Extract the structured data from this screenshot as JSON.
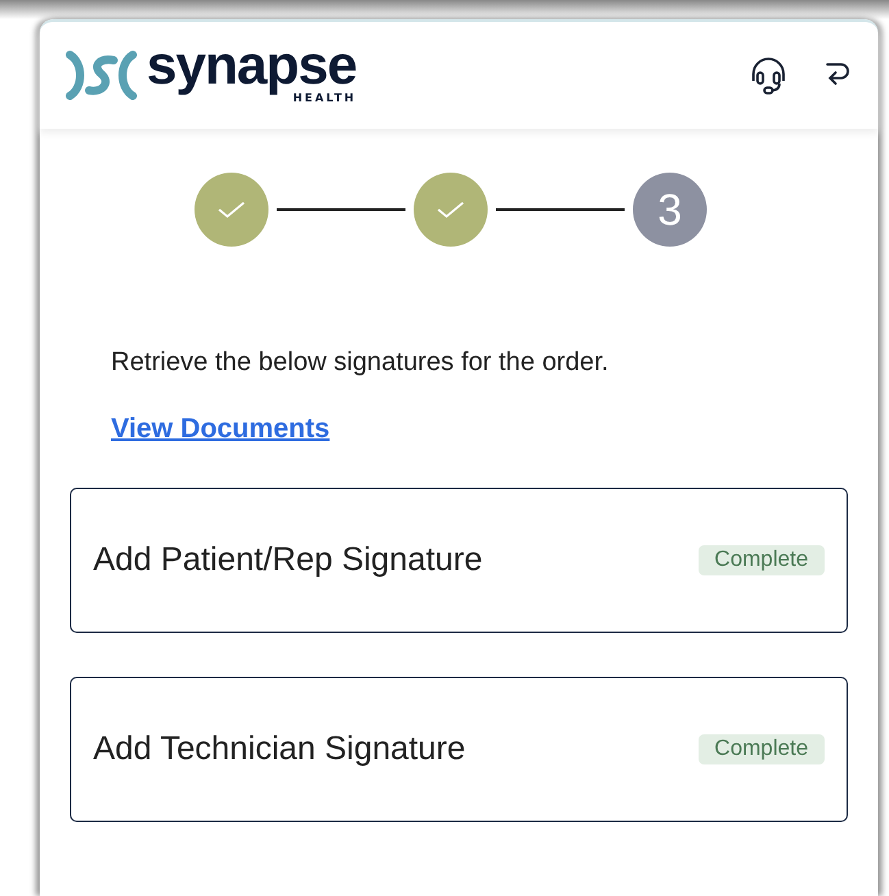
{
  "header": {
    "logo_text": "synapse",
    "logo_subtext": "HEALTH"
  },
  "steps": [
    {
      "done": true
    },
    {
      "done": true
    },
    {
      "label": "3",
      "done": false
    }
  ],
  "instruction": "Retrieve the below signatures for the order.",
  "link": "View Documents",
  "signatures": [
    {
      "title": "Add Patient/Rep Signature",
      "status": "Complete"
    },
    {
      "title": "Add Technician Signature",
      "status": "Complete"
    }
  ]
}
